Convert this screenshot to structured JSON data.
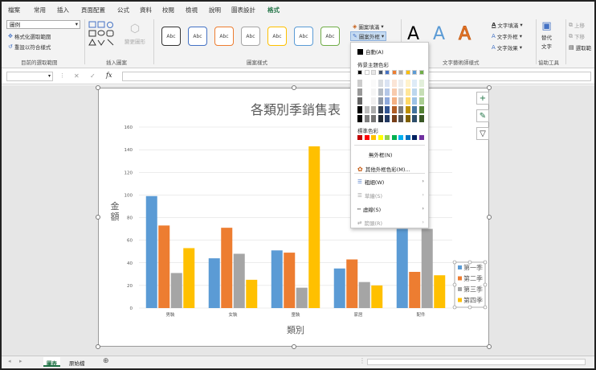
{
  "tabs": [
    "檔案",
    "常用",
    "插入",
    "頁面配置",
    "公式",
    "資料",
    "校閱",
    "檢視",
    "說明",
    "圖表設計",
    "格式"
  ],
  "active_tab": "格式",
  "ribbon": {
    "current_selection": {
      "combo_value": "圖例",
      "format_selection": "格式化選取範圍",
      "reset_style": "重設以符合樣式",
      "label": "目前的選取範圍"
    },
    "insert_shapes": {
      "change_shape": "變更圖形",
      "label": "插入圖案"
    },
    "shape_styles": {
      "style_text": "Abc",
      "style_colors": [
        "#333333",
        "#4472c4",
        "#ed7d31",
        "#a5a5a5",
        "#ffc000",
        "#5b9bd5",
        "#70ad47"
      ],
      "label": "圖案樣式",
      "fill": "圖案填滿",
      "outline": "圖案外框"
    },
    "wordart": {
      "letter": "A",
      "colors": [
        "#000000",
        "#5b9bd5",
        "#ed7d31"
      ],
      "text_fill": "文字填滿",
      "text_outline": "文字外框",
      "text_effects": "文字效果",
      "label": "文字藝術師樣式"
    },
    "accessibility": {
      "alt_text_1": "替代",
      "alt_text_2": "文字",
      "label": "協助工具"
    },
    "arrange": {
      "bring_forward": "上移",
      "send_backward": "下移",
      "selection_pane": "選取範"
    }
  },
  "formula_bar": {
    "fx": "fx",
    "cancel": "✕",
    "enter": "✓"
  },
  "chart_data": {
    "type": "bar",
    "title": "各類別季銷售表",
    "xlabel": "類別",
    "ylabel": "金額",
    "categories": [
      "男裝",
      "女裝",
      "童裝",
      "家居",
      "配件"
    ],
    "ylim": [
      0,
      160
    ],
    "yticks": [
      0,
      20,
      40,
      60,
      80,
      100,
      120,
      140,
      160
    ],
    "grid": true,
    "legend_position": "right",
    "series": [
      {
        "name": "第一季",
        "color": "#5b9bd5",
        "values": [
          99,
          44,
          51,
          35,
          70
        ]
      },
      {
        "name": "第二季",
        "color": "#ed7d31",
        "values": [
          73,
          71,
          49,
          43,
          32
        ]
      },
      {
        "name": "第三季",
        "color": "#a5a5a5",
        "values": [
          31,
          48,
          18,
          23,
          70
        ]
      },
      {
        "name": "第四季",
        "color": "#ffc000",
        "values": [
          53,
          25,
          143,
          20,
          29
        ]
      }
    ]
  },
  "dropdown": {
    "automatic": "自動(A)",
    "theme_colors_label": "佈景主題色彩",
    "theme_base": [
      "#000000",
      "#ffffff",
      "#e7e6e6",
      "#44546a",
      "#4472c4",
      "#ed7d31",
      "#a5a5a5",
      "#ffc000",
      "#5b9bd5",
      "#70ad47"
    ],
    "standard_colors_label": "標準色彩",
    "standard_colors": [
      "#c00000",
      "#ff0000",
      "#ffc000",
      "#ffff00",
      "#92d050",
      "#00b050",
      "#00b0f0",
      "#0070c0",
      "#002060",
      "#7030a0"
    ],
    "no_outline": "無外框(N)",
    "more_colors": "其他外框色彩(M)...",
    "weight": "粗細(W)",
    "sketch": "草繪(S)",
    "dashes": "虛線(S)",
    "arrows": "箭頭(R)"
  },
  "sheets": [
    "圖表",
    "原始檔"
  ],
  "add_sheet": "⊕"
}
